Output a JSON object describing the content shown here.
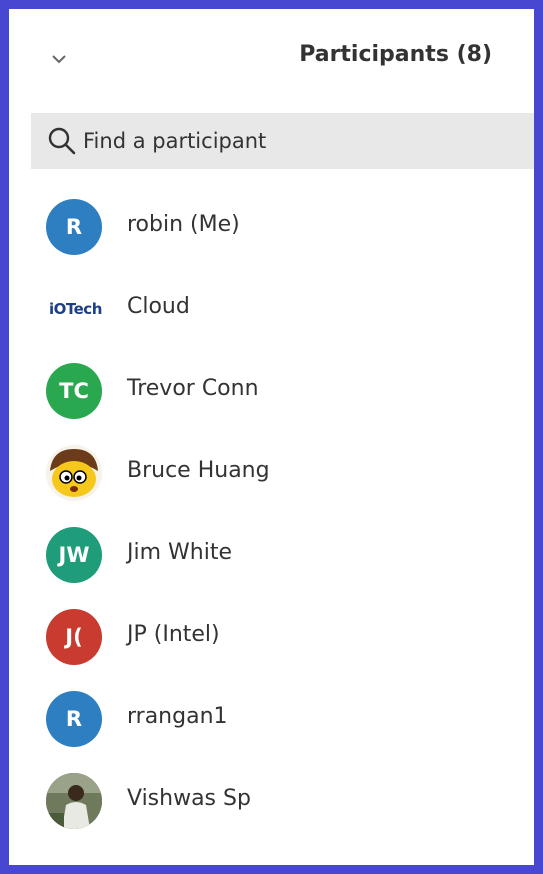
{
  "header": {
    "title": "Participants (8)"
  },
  "search": {
    "placeholder": "Find a participant"
  },
  "participants": [
    {
      "initials": "R",
      "name": "robin (Me)",
      "color": "#2d7fc1"
    },
    {
      "initials": "iOTech",
      "name": "Cloud",
      "color": "#1d3f86"
    },
    {
      "initials": "TC",
      "name": "Trevor Conn",
      "color": "#2aa84f"
    },
    {
      "initials": "",
      "name": "Bruce Huang",
      "color": "#f2c200"
    },
    {
      "initials": "JW",
      "name": "Jim White",
      "color": "#1f9c7a"
    },
    {
      "initials": "J(",
      "name": "JP (Intel)",
      "color": "#c93a2f"
    },
    {
      "initials": "R",
      "name": "rrangan1",
      "color": "#2d7fc1"
    },
    {
      "initials": "",
      "name": "Vishwas Sp",
      "color": "#5a6b4a"
    }
  ],
  "icons": {
    "collapse": "chevron-down-icon",
    "search": "search-icon"
  }
}
